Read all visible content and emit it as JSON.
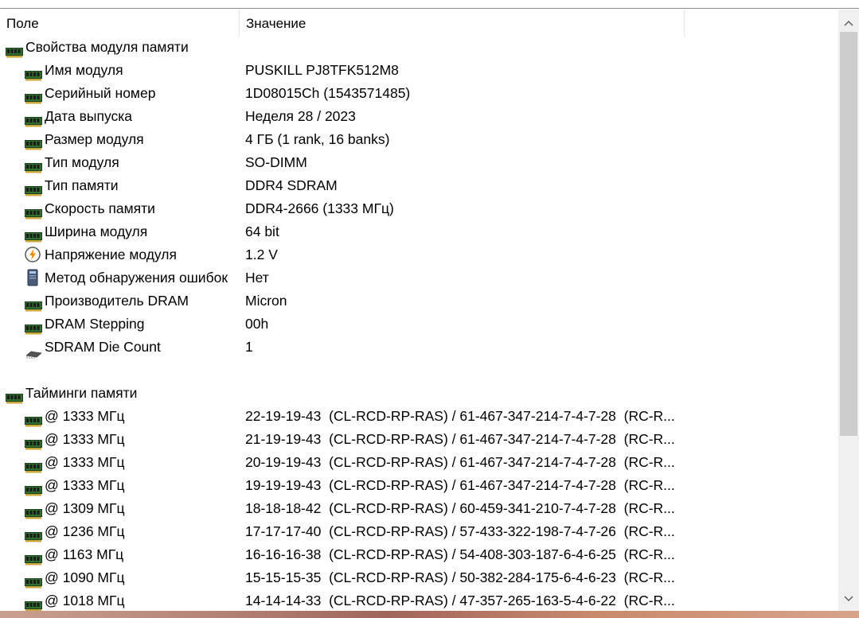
{
  "header": {
    "field": "Поле",
    "value": "Значение"
  },
  "rows": [
    {
      "type": "group",
      "icon": "memory-module-icon",
      "field": "Свойства модуля памяти",
      "value": ""
    },
    {
      "type": "item",
      "icon": "memory-module-icon",
      "field": "Имя модуля",
      "value": "PUSKILL PJ8TFK512M8"
    },
    {
      "type": "item",
      "icon": "memory-module-icon",
      "field": "Серийный номер",
      "value": "1D08015Ch (1543571485)"
    },
    {
      "type": "item",
      "icon": "memory-module-icon",
      "field": "Дата выпуска",
      "value": "Неделя 28 / 2023"
    },
    {
      "type": "item",
      "icon": "memory-module-icon",
      "field": "Размер модуля",
      "value": "4 ГБ (1 rank, 16 banks)"
    },
    {
      "type": "item",
      "icon": "memory-module-icon",
      "field": "Тип модуля",
      "value": "SO-DIMM"
    },
    {
      "type": "item",
      "icon": "memory-module-icon",
      "field": "Тип памяти",
      "value": "DDR4 SDRAM"
    },
    {
      "type": "item",
      "icon": "memory-module-icon",
      "field": "Скорость памяти",
      "value": "DDR4-2666 (1333 МГц)"
    },
    {
      "type": "item",
      "icon": "memory-module-icon",
      "field": "Ширина модуля",
      "value": "64 bit"
    },
    {
      "type": "item",
      "icon": "lightning-icon",
      "field": "Напряжение модуля",
      "value": "1.2 V"
    },
    {
      "type": "item",
      "icon": "shield-icon",
      "field": "Метод обнаружения ошибок",
      "value": "Нет"
    },
    {
      "type": "item",
      "icon": "memory-module-icon",
      "field": "Производитель DRAM",
      "value": "Micron"
    },
    {
      "type": "item",
      "icon": "memory-module-icon",
      "field": "DRAM Stepping",
      "value": "00h"
    },
    {
      "type": "item",
      "icon": "chip-icon",
      "field": "SDRAM Die Count",
      "value": "1"
    },
    {
      "type": "blank",
      "icon": "",
      "field": "",
      "value": ""
    },
    {
      "type": "group",
      "icon": "memory-module-icon",
      "field": "Тайминги памяти",
      "value": ""
    },
    {
      "type": "item",
      "icon": "memory-module-icon",
      "field": "@ 1333 МГц",
      "value": "22-19-19-43  (CL-RCD-RP-RAS) / 61-467-347-214-7-4-7-28  (RC-R..."
    },
    {
      "type": "item",
      "icon": "memory-module-icon",
      "field": "@ 1333 МГц",
      "value": "21-19-19-43  (CL-RCD-RP-RAS) / 61-467-347-214-7-4-7-28  (RC-R..."
    },
    {
      "type": "item",
      "icon": "memory-module-icon",
      "field": "@ 1333 МГц",
      "value": "20-19-19-43  (CL-RCD-RP-RAS) / 61-467-347-214-7-4-7-28  (RC-R..."
    },
    {
      "type": "item",
      "icon": "memory-module-icon",
      "field": "@ 1333 МГц",
      "value": "19-19-19-43  (CL-RCD-RP-RAS) / 61-467-347-214-7-4-7-28  (RC-R..."
    },
    {
      "type": "item",
      "icon": "memory-module-icon",
      "field": "@ 1309 МГц",
      "value": "18-18-18-42  (CL-RCD-RP-RAS) / 60-459-341-210-7-4-7-28  (RC-R..."
    },
    {
      "type": "item",
      "icon": "memory-module-icon",
      "field": "@ 1236 МГц",
      "value": "17-17-17-40  (CL-RCD-RP-RAS) / 57-433-322-198-7-4-7-26  (RC-R..."
    },
    {
      "type": "item",
      "icon": "memory-module-icon",
      "field": "@ 1163 МГц",
      "value": "16-16-16-38  (CL-RCD-RP-RAS) / 54-408-303-187-6-4-6-25  (RC-R..."
    },
    {
      "type": "item",
      "icon": "memory-module-icon",
      "field": "@ 1090 МГц",
      "value": "15-15-15-35  (CL-RCD-RP-RAS) / 50-382-284-175-6-4-6-23  (RC-R..."
    },
    {
      "type": "item",
      "icon": "memory-module-icon",
      "field": "@ 1018 МГц",
      "value": "14-14-14-33  (CL-RCD-RP-RAS) / 47-357-265-163-5-4-6-22  (RC-R..."
    }
  ],
  "scrollbar": {
    "up_icon": "chevron-up-icon",
    "down_icon": "chevron-down-icon"
  }
}
